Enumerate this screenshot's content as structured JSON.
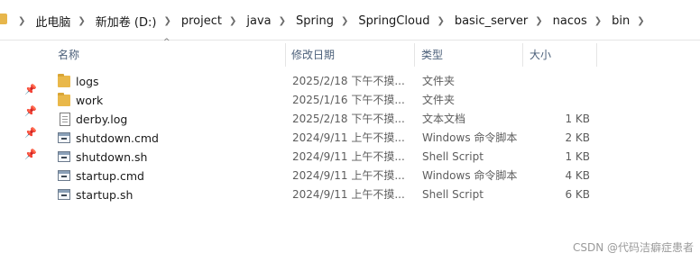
{
  "breadcrumb": [
    "此电脑",
    "新加卷 (D:)",
    "project",
    "java",
    "Spring",
    "SpringCloud",
    "basic_server",
    "nacos",
    "bin"
  ],
  "columns": {
    "name": "名称",
    "date": "修改日期",
    "type": "类型",
    "size": "大小"
  },
  "files": [
    {
      "name": "logs",
      "date": "2025/2/18 下午不摸...",
      "type": "文件夹",
      "size": "",
      "icon": "folder-icon"
    },
    {
      "name": "work",
      "date": "2025/1/16 下午不摸...",
      "type": "文件夹",
      "size": "",
      "icon": "folder-icon"
    },
    {
      "name": "derby.log",
      "date": "2025/2/18 下午不摸...",
      "type": "文本文档",
      "size": "1 KB",
      "icon": "text-file-icon"
    },
    {
      "name": "shutdown.cmd",
      "date": "2024/9/11 上午不摸...",
      "type": "Windows 命令脚本",
      "size": "2 KB",
      "icon": "script-file-icon"
    },
    {
      "name": "shutdown.sh",
      "date": "2024/9/11 上午不摸...",
      "type": "Shell Script",
      "size": "1 KB",
      "icon": "script-file-icon"
    },
    {
      "name": "startup.cmd",
      "date": "2024/9/11 上午不摸...",
      "type": "Windows 命令脚本",
      "size": "4 KB",
      "icon": "script-file-icon"
    },
    {
      "name": "startup.sh",
      "date": "2024/9/11 上午不摸...",
      "type": "Shell Script",
      "size": "6 KB",
      "icon": "script-file-icon"
    }
  ],
  "watermark": "CSDN @代码洁癖症患者",
  "colors": {
    "header_text": "#4c607a",
    "folder": "#e9b84a",
    "secondary_text": "#5d5d5d"
  }
}
